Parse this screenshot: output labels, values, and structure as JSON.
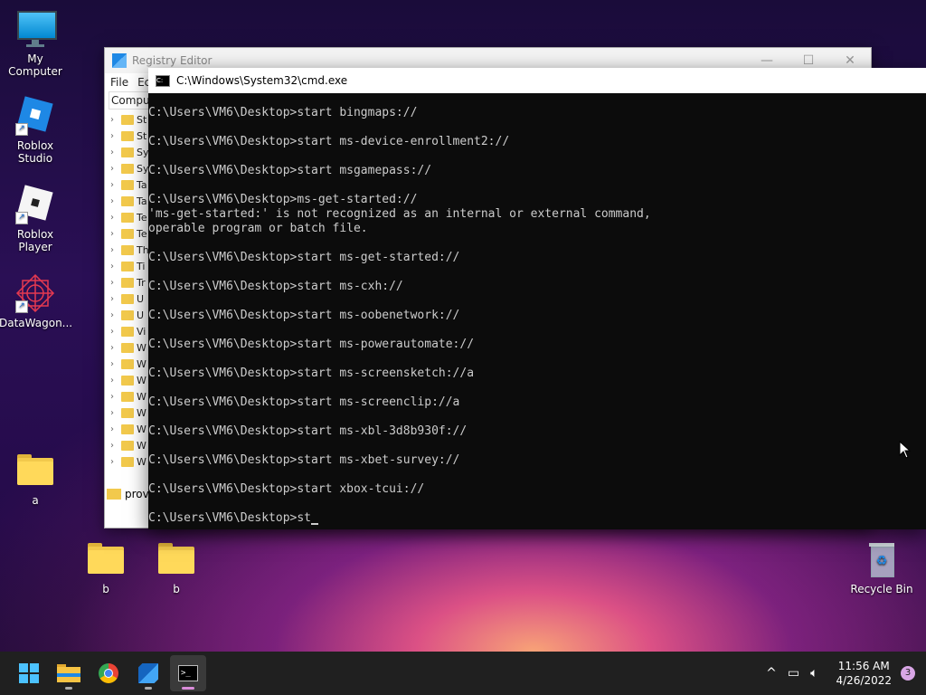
{
  "desktop": {
    "icons": [
      {
        "label": "My Computer"
      },
      {
        "label": "Roblox Studio"
      },
      {
        "label": "Roblox Player"
      },
      {
        "label": "DataWagon..."
      },
      {
        "label": "a"
      },
      {
        "label": "b"
      },
      {
        "label": "b"
      },
      {
        "label": "Recycle Bin"
      }
    ]
  },
  "regedit": {
    "title": "Registry Editor",
    "menu": [
      "File",
      "Ec"
    ],
    "address": "Comput",
    "tree": [
      "St",
      "St",
      "Sy",
      "Sy",
      "Ta",
      "Ta",
      "Te",
      "Te",
      "Th",
      "Ti",
      "Tr",
      "U",
      "U",
      "Vi",
      "W",
      "W",
      "W",
      "W",
      "W",
      "W",
      "W",
      "W"
    ],
    "status_label": "prov",
    "controls": {
      "minimize": "—",
      "maximize": "☐",
      "close": "✕"
    }
  },
  "cmd": {
    "title": "C:\\Windows\\System32\\cmd.exe",
    "lines": [
      "C:\\Users\\VM6\\Desktop>start bingmaps://",
      "",
      "C:\\Users\\VM6\\Desktop>start ms-device-enrollment2://",
      "",
      "C:\\Users\\VM6\\Desktop>start msgamepass://",
      "",
      "C:\\Users\\VM6\\Desktop>ms-get-started://",
      "'ms-get-started:' is not recognized as an internal or external command,",
      "operable program or batch file.",
      "",
      "C:\\Users\\VM6\\Desktop>start ms-get-started://",
      "",
      "C:\\Users\\VM6\\Desktop>start ms-cxh://",
      "",
      "C:\\Users\\VM6\\Desktop>start ms-oobenetwork://",
      "",
      "C:\\Users\\VM6\\Desktop>start ms-powerautomate://",
      "",
      "C:\\Users\\VM6\\Desktop>start ms-screensketch://a",
      "",
      "C:\\Users\\VM6\\Desktop>start ms-screenclip://a",
      "",
      "C:\\Users\\VM6\\Desktop>start ms-xbl-3d8b930f://",
      "",
      "C:\\Users\\VM6\\Desktop>start ms-xbet-survey://",
      "",
      "C:\\Users\\VM6\\Desktop>start xbox-tcui://",
      ""
    ],
    "prompt": "C:\\Users\\VM6\\Desktop>st"
  },
  "taskbar": {
    "apps": [
      "start",
      "file-explorer",
      "chrome",
      "registry-editor",
      "command-prompt"
    ],
    "tray_chevron": "^",
    "network_icon": "network-icon",
    "volume_icon": "volume-icon",
    "time": "11:56 AM",
    "date": "4/26/2022",
    "notification_count": "3"
  }
}
